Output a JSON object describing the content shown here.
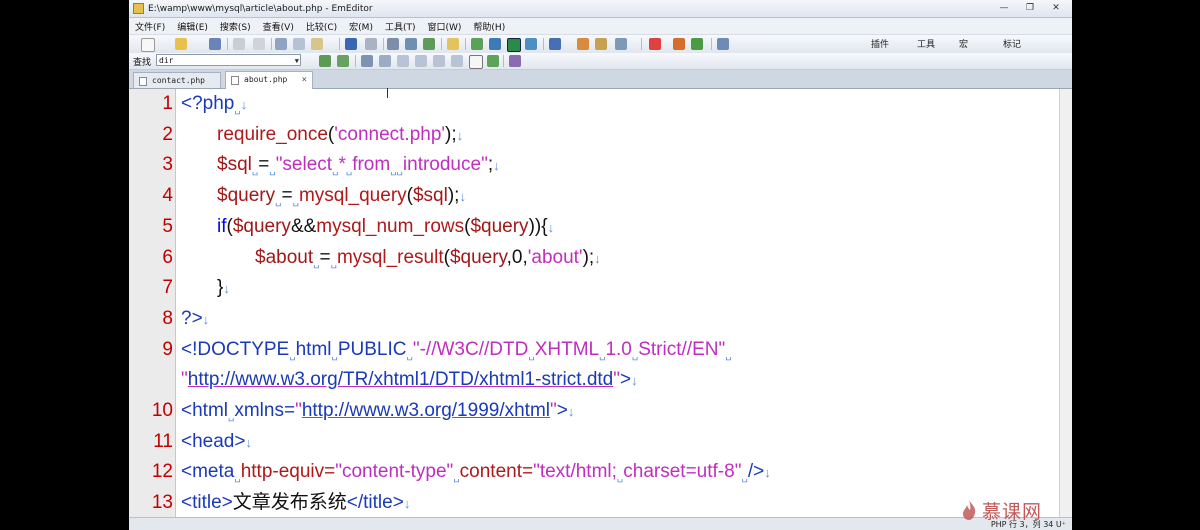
{
  "window": {
    "title": "E:\\wamp\\www\\mysql\\article\\about.php - EmEditor",
    "buttons": [
      "—",
      "❐",
      "✕"
    ]
  },
  "menu": [
    "文件(F)",
    "编辑(E)",
    "搜索(S)",
    "查看(V)",
    "比较(C)",
    "宏(M)",
    "工具(T)",
    "窗口(W)",
    "帮助(H)"
  ],
  "toolbar_right": [
    "插件",
    "工具",
    "宏",
    "标记"
  ],
  "find": {
    "label": "查找",
    "value": "dir"
  },
  "tabs": [
    {
      "label": "contact.php",
      "active": false
    },
    {
      "label": "about.php",
      "active": true,
      "close": "×"
    }
  ],
  "lines": [
    {
      "num": "1",
      "indent": 0,
      "segments": [
        {
          "t": "<?php",
          "c": "tag"
        },
        {
          "t": "␣",
          "c": "mk"
        },
        {
          "t": "↓",
          "c": "eol"
        }
      ]
    },
    {
      "num": "2",
      "indent": 1,
      "segments": [
        {
          "t": "require_once",
          "c": "fn"
        },
        {
          "t": "(",
          "c": "dark"
        },
        {
          "t": "'connect.php'",
          "c": "str"
        },
        {
          "t": ");",
          "c": "dark"
        },
        {
          "t": "↓",
          "c": "eol"
        }
      ]
    },
    {
      "num": "3",
      "indent": 1,
      "segments": [
        {
          "t": "$sql",
          "c": "var"
        },
        {
          "t": "␣",
          "c": "mk"
        },
        {
          "t": "=",
          "c": "dark"
        },
        {
          "t": "␣",
          "c": "mk"
        },
        {
          "t": "\"select",
          "c": "str"
        },
        {
          "t": "␣",
          "c": "mk"
        },
        {
          "t": "*",
          "c": "str"
        },
        {
          "t": "␣",
          "c": "mk"
        },
        {
          "t": "from",
          "c": "str"
        },
        {
          "t": "␣␣",
          "c": "mk"
        },
        {
          "t": "introduce\"",
          "c": "str"
        },
        {
          "t": ";",
          "c": "dark"
        },
        {
          "t": "↓",
          "c": "eol"
        }
      ]
    },
    {
      "num": "4",
      "indent": 1,
      "segments": [
        {
          "t": "$query",
          "c": "var"
        },
        {
          "t": "␣",
          "c": "mk"
        },
        {
          "t": "=",
          "c": "dark"
        },
        {
          "t": "␣",
          "c": "mk"
        },
        {
          "t": "mysql_query",
          "c": "fn"
        },
        {
          "t": "(",
          "c": "dark"
        },
        {
          "t": "$sql",
          "c": "var"
        },
        {
          "t": ");",
          "c": "dark"
        },
        {
          "t": "↓",
          "c": "eol"
        }
      ]
    },
    {
      "num": "5",
      "indent": 1,
      "segments": [
        {
          "t": "if",
          "c": "kw"
        },
        {
          "t": "(",
          "c": "dark"
        },
        {
          "t": "$query",
          "c": "var"
        },
        {
          "t": "&&",
          "c": "dark"
        },
        {
          "t": "mysql_num_rows",
          "c": "fn"
        },
        {
          "t": "(",
          "c": "dark"
        },
        {
          "t": "$query",
          "c": "var"
        },
        {
          "t": ")){",
          "c": "dark"
        },
        {
          "t": "↓",
          "c": "eol"
        }
      ]
    },
    {
      "num": "6",
      "indent": 2,
      "segments": [
        {
          "t": "$about",
          "c": "var"
        },
        {
          "t": "␣",
          "c": "mk"
        },
        {
          "t": "=",
          "c": "dark"
        },
        {
          "t": "␣",
          "c": "mk"
        },
        {
          "t": "mysql_result",
          "c": "fn"
        },
        {
          "t": "(",
          "c": "dark"
        },
        {
          "t": "$query",
          "c": "var"
        },
        {
          "t": ",0,",
          "c": "dark"
        },
        {
          "t": "'about'",
          "c": "str"
        },
        {
          "t": ");",
          "c": "dark"
        },
        {
          "t": "↓",
          "c": "eol"
        }
      ]
    },
    {
      "num": "7",
      "indent": 1,
      "segments": [
        {
          "t": "}",
          "c": "dark"
        },
        {
          "t": "↓",
          "c": "eol"
        }
      ]
    },
    {
      "num": "8",
      "indent": 0,
      "segments": [
        {
          "t": "?>",
          "c": "tag"
        },
        {
          "t": "↓",
          "c": "eol"
        }
      ]
    },
    {
      "num": "9",
      "indent": 0,
      "segments": [
        {
          "t": "<!DOCTYPE",
          "c": "tag"
        },
        {
          "t": "␣",
          "c": "mk"
        },
        {
          "t": "html",
          "c": "tag"
        },
        {
          "t": "␣",
          "c": "mk"
        },
        {
          "t": "PUBLIC",
          "c": "tag"
        },
        {
          "t": "␣",
          "c": "mk"
        },
        {
          "t": "\"-//W3C//DTD",
          "c": "str"
        },
        {
          "t": "␣",
          "c": "mk"
        },
        {
          "t": "XHTML",
          "c": "str"
        },
        {
          "t": "␣",
          "c": "mk"
        },
        {
          "t": "1.0",
          "c": "str"
        },
        {
          "t": "␣",
          "c": "mk"
        },
        {
          "t": "Strict//EN\"",
          "c": "str"
        },
        {
          "t": "␣",
          "c": "mk"
        }
      ]
    },
    {
      "num": "",
      "indent": 0,
      "segments": [
        {
          "t": "\"",
          "c": "str"
        },
        {
          "t": "http://www.w3.org/TR/xhtml1/DTD/xhtml1-strict.dtd",
          "c": "url"
        },
        {
          "t": "\"",
          "c": "str"
        },
        {
          "t": ">",
          "c": "tag"
        },
        {
          "t": "↓",
          "c": "eol"
        }
      ]
    },
    {
      "num": "10",
      "indent": 0,
      "segments": [
        {
          "t": "<html",
          "c": "tag"
        },
        {
          "t": "␣",
          "c": "mk"
        },
        {
          "t": "xmlns=",
          "c": "tag"
        },
        {
          "t": "\"",
          "c": "str"
        },
        {
          "t": "http://www.w3.org/1999/xhtml",
          "c": "url"
        },
        {
          "t": "\"",
          "c": "str"
        },
        {
          "t": ">",
          "c": "tag"
        },
        {
          "t": "↓",
          "c": "eol"
        }
      ]
    },
    {
      "num": "11",
      "indent": 0,
      "segments": [
        {
          "t": "<head>",
          "c": "tag"
        },
        {
          "t": "↓",
          "c": "eol"
        }
      ]
    },
    {
      "num": "12",
      "indent": 0,
      "segments": [
        {
          "t": "<meta",
          "c": "tag"
        },
        {
          "t": "␣",
          "c": "mk"
        },
        {
          "t": "http-equiv=",
          "c": "fn"
        },
        {
          "t": "\"content-type\"",
          "c": "str"
        },
        {
          "t": "␣",
          "c": "mk"
        },
        {
          "t": "content=",
          "c": "fn"
        },
        {
          "t": "\"text/html;",
          "c": "str"
        },
        {
          "t": "␣",
          "c": "mk"
        },
        {
          "t": "charset=utf-8\"",
          "c": "str"
        },
        {
          "t": "␣",
          "c": "mk"
        },
        {
          "t": "/>",
          "c": "tag"
        },
        {
          "t": "↓",
          "c": "eol"
        }
      ]
    },
    {
      "num": "13",
      "indent": 0,
      "segments": [
        {
          "t": "<title>",
          "c": "tag"
        },
        {
          "t": "文章发布系统",
          "c": "dark"
        },
        {
          "t": "</title>",
          "c": "tag"
        },
        {
          "t": "↓",
          "c": "eol"
        }
      ]
    }
  ],
  "status": "PHP  行 3，列 34   U⁺",
  "watermark": "慕课网",
  "colors": {
    "tag": "#1a3ab8",
    "keyword": "#0000ff",
    "function": "#b01919",
    "string": "#c02ec0",
    "linenum": "#c00000"
  }
}
